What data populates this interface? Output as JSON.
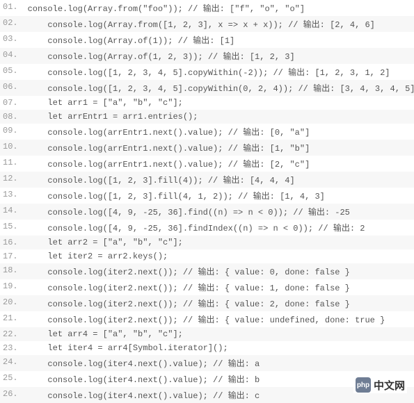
{
  "lines": [
    {
      "num": "01.",
      "indent": 0,
      "code": "console.log(Array.from(\"foo\")); // 输出: [\"f\", \"o\", \"o\"]"
    },
    {
      "num": "02.",
      "indent": 1,
      "code": "console.log(Array.from([1, 2, 3], x => x + x)); // 输出: [2, 4, 6]"
    },
    {
      "num": "03.",
      "indent": 1,
      "code": "console.log(Array.of(1)); // 输出: [1]"
    },
    {
      "num": "04.",
      "indent": 1,
      "code": "console.log(Array.of(1, 2, 3)); // 输出: [1, 2, 3]"
    },
    {
      "num": "05.",
      "indent": 1,
      "code": "console.log([1, 2, 3, 4, 5].copyWithin(-2)); // 输出: [1, 2, 3, 1, 2]"
    },
    {
      "num": "06.",
      "indent": 1,
      "code": "console.log([1, 2, 3, 4, 5].copyWithin(0, 2, 4)); // 输出: [3, 4, 3, 4, 5]"
    },
    {
      "num": "07.",
      "indent": 1,
      "code": "let arr1 = [\"a\", \"b\", \"c\"];"
    },
    {
      "num": "08.",
      "indent": 1,
      "code": "let arrEntr1 = arr1.entries();"
    },
    {
      "num": "09.",
      "indent": 1,
      "code": "console.log(arrEntr1.next().value); // 输出: [0, \"a\"]"
    },
    {
      "num": "10.",
      "indent": 1,
      "code": "console.log(arrEntr1.next().value); // 输出: [1, \"b\"]"
    },
    {
      "num": "11.",
      "indent": 1,
      "code": "console.log(arrEntr1.next().value); // 输出: [2, \"c\"]"
    },
    {
      "num": "12.",
      "indent": 1,
      "code": "console.log([1, 2, 3].fill(4)); // 输出: [4, 4, 4]"
    },
    {
      "num": "13.",
      "indent": 1,
      "code": "console.log([1, 2, 3].fill(4, 1, 2)); // 输出: [1, 4, 3]"
    },
    {
      "num": "14.",
      "indent": 1,
      "code": "console.log([4, 9, -25, 36].find((n) => n < 0)); // 输出: -25"
    },
    {
      "num": "15.",
      "indent": 1,
      "code": "console.log([4, 9, -25, 36].findIndex((n) => n < 0)); // 输出: 2"
    },
    {
      "num": "16.",
      "indent": 1,
      "code": "let arr2 = [\"a\", \"b\", \"c\"];"
    },
    {
      "num": "17.",
      "indent": 1,
      "code": "let iter2 = arr2.keys();"
    },
    {
      "num": "18.",
      "indent": 1,
      "code": "console.log(iter2.next()); // 输出: { value: 0, done: false }"
    },
    {
      "num": "19.",
      "indent": 1,
      "code": "console.log(iter2.next()); // 输出: { value: 1, done: false }"
    },
    {
      "num": "20.",
      "indent": 1,
      "code": "console.log(iter2.next()); // 输出: { value: 2, done: false }"
    },
    {
      "num": "21.",
      "indent": 1,
      "code": "console.log(iter2.next()); // 输出: { value: undefined, done: true }"
    },
    {
      "num": "22.",
      "indent": 1,
      "code": "let arr4 = [\"a\", \"b\", \"c\"];"
    },
    {
      "num": "23.",
      "indent": 1,
      "code": "let iter4 = arr4[Symbol.iterator]();"
    },
    {
      "num": "24.",
      "indent": 1,
      "code": "console.log(iter4.next().value); // 输出: a"
    },
    {
      "num": "25.",
      "indent": 1,
      "code": "console.log(iter4.next().value); // 输出: b"
    },
    {
      "num": "26.",
      "indent": 1,
      "code": "console.log(iter4.next().value); // 输出: c"
    }
  ],
  "watermark": {
    "logo": "php",
    "text": "中文网"
  }
}
